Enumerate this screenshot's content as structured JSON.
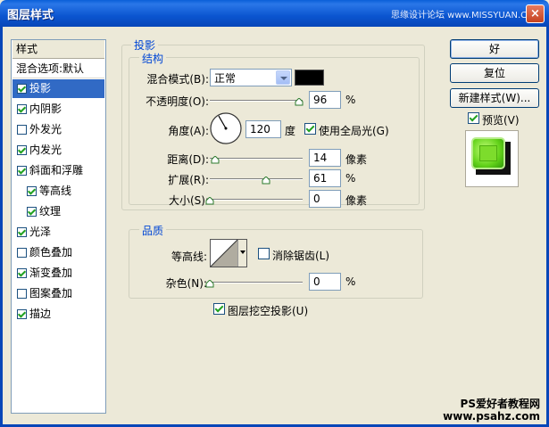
{
  "window": {
    "title": "图层样式",
    "watermark": "思缘设计论坛 www.MISSYUAN.COM",
    "close": "×"
  },
  "stylelist": {
    "header": "样式",
    "blend_default": "混合选项:默认",
    "items": [
      {
        "label": "投影",
        "checked": true,
        "selected": true
      },
      {
        "label": "内阴影",
        "checked": true
      },
      {
        "label": "外发光",
        "checked": false
      },
      {
        "label": "内发光",
        "checked": true
      },
      {
        "label": "斜面和浮雕",
        "checked": true
      },
      {
        "label": "等高线",
        "checked": true,
        "indent": true
      },
      {
        "label": "纹理",
        "checked": true,
        "indent": true
      },
      {
        "label": "光泽",
        "checked": true
      },
      {
        "label": "颜色叠加",
        "checked": false
      },
      {
        "label": "渐变叠加",
        "checked": true
      },
      {
        "label": "图案叠加",
        "checked": false
      },
      {
        "label": "描边",
        "checked": true
      }
    ]
  },
  "shadow": {
    "group_title": "投影",
    "structure_title": "结构",
    "blend_mode_label": "混合模式(B):",
    "blend_mode_value": "正常",
    "shadow_color": "#000000",
    "opacity_label": "不透明度(O):",
    "opacity_value": "96",
    "opacity_unit": "%",
    "angle_label": "角度(A):",
    "angle_value": "120",
    "angle_unit": "度",
    "global_light_label": "使用全局光(G)",
    "global_light_checked": true,
    "distance_label": "距离(D):",
    "distance_value": "14",
    "distance_unit": "像素",
    "spread_label": "扩展(R):",
    "spread_value": "61",
    "spread_unit": "%",
    "size_label": "大小(S):",
    "size_value": "0",
    "size_unit": "像素"
  },
  "quality": {
    "title": "品质",
    "contour_label": "等高线:",
    "antialias_label": "消除锯齿(L)",
    "antialias_checked": false,
    "noise_label": "杂色(N):",
    "noise_value": "0",
    "noise_unit": "%"
  },
  "knockout_label": "图层挖空投影(U)",
  "knockout_checked": true,
  "buttons": {
    "ok": "好",
    "reset": "复位",
    "new_style": "新建样式(W)...",
    "preview_label": "预览(V)",
    "preview_checked": true
  },
  "footer": {
    "line1": "PS爱好者教程网",
    "line2": "www.psahz.com"
  }
}
